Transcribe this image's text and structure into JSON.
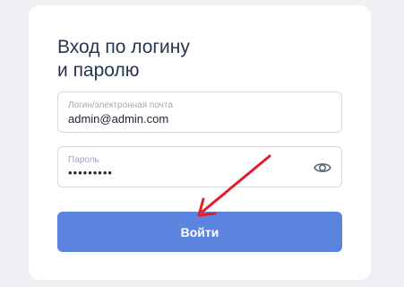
{
  "form": {
    "title": "Вход по логину\nи паролю",
    "login": {
      "label": "Логин/электронная почта",
      "value": "admin@admin.com"
    },
    "password": {
      "label": "Пароль",
      "value": "•••••••••"
    },
    "submit_label": "Войти"
  },
  "icons": {
    "password_toggle": "eye-icon",
    "annotation": "red-arrow"
  },
  "colors": {
    "accent": "#5b84df",
    "title": "#27354f",
    "annotation": "#e11d26"
  }
}
